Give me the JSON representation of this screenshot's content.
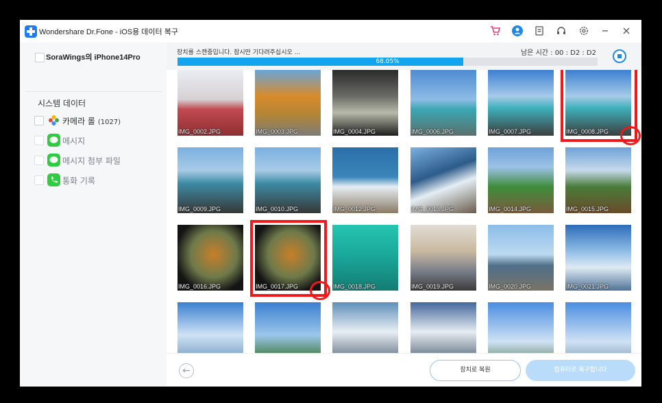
{
  "app": {
    "title": "Wondershare Dr.Fone - iOS용 데이터 복구",
    "accent_color": "#1e88e5",
    "titlebar_icons": [
      "cart-icon",
      "user-icon",
      "feedback-icon",
      "headset-icon",
      "settings-icon",
      "minimize-icon",
      "close-icon"
    ]
  },
  "sidebar": {
    "device_name": "SoraWings의 iPhone14Pro",
    "section_title": "시스템 데이터",
    "items": [
      {
        "label": "카메라 롤",
        "count": "(1027)",
        "icon": "photos-icon",
        "enabled": true
      },
      {
        "label": "메시지",
        "icon": "messages-icon",
        "enabled": false
      },
      {
        "label": "메시지 첨부 파일",
        "icon": "message-attachment-icon",
        "enabled": false
      },
      {
        "label": "통화 기록",
        "icon": "phone-icon",
        "enabled": false
      }
    ]
  },
  "scan": {
    "status": "장치를 스캔중입니다. 잠시만 기다려주십시오 ...",
    "time_left": "남은 시간 : 00 :  D2 :  D2",
    "progress_text": "68.05%",
    "progress": 0.6805
  },
  "photos": [
    {
      "name": "IMG_0002.JPG"
    },
    {
      "name": "IMG_0003.JPG"
    },
    {
      "name": "IMG_0004.JPG"
    },
    {
      "name": "IMG_0006.JPG"
    },
    {
      "name": "IMG_0007.JPG"
    },
    {
      "name": "IMG_0008.JPG",
      "highlighted": true
    },
    {
      "name": "IMG_0009.JPG"
    },
    {
      "name": "IMG_0010.JPG"
    },
    {
      "name": "IMG_0012.JPG"
    },
    {
      "name": "IMG_0013.JPG"
    },
    {
      "name": "IMG_0014.JPG"
    },
    {
      "name": "IMG_0015.JPG"
    },
    {
      "name": "IMG_0016.JPG"
    },
    {
      "name": "IMG_0017.JPG",
      "highlighted": true
    },
    {
      "name": "IMG_0018.JPG"
    },
    {
      "name": "IMG_0019.JPG"
    },
    {
      "name": "IMG_0020.JPG"
    },
    {
      "name": "IMG_0021.JPG"
    },
    {
      "name": ""
    },
    {
      "name": ""
    },
    {
      "name": ""
    },
    {
      "name": ""
    },
    {
      "name": ""
    },
    {
      "name": ""
    }
  ],
  "footer": {
    "restore_device_label": "장치로 복원",
    "restore_pc_label": "컴퓨터로 복구합니다"
  }
}
